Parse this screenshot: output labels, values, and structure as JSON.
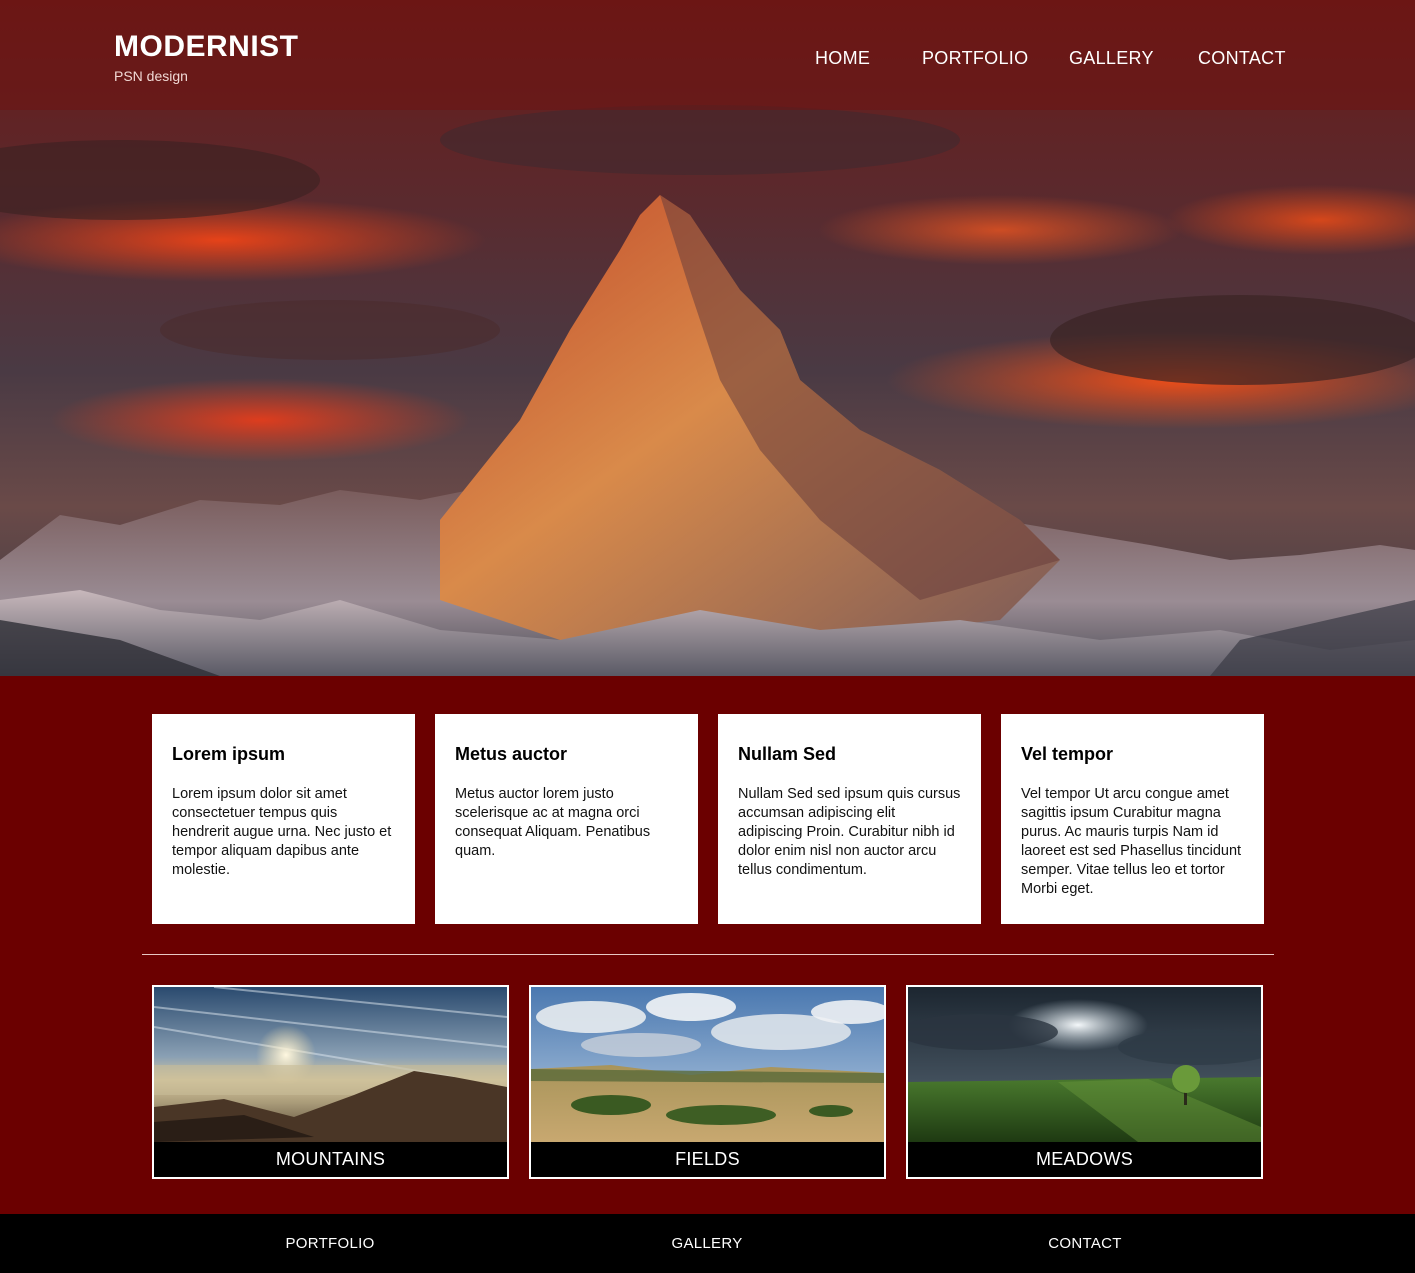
{
  "header": {
    "title": "MODERNIST",
    "subtitle": "PSN design",
    "nav": [
      "HOME",
      "PORTFOLIO",
      "GALLERY",
      "CONTACT"
    ]
  },
  "cards": [
    {
      "title": "Lorem ipsum",
      "text": "Lorem ipsum dolor sit amet consectetuer tempus quis hendrerit augue urna. Nec justo et tempor aliquam dapibus ante molestie."
    },
    {
      "title": "Metus auctor",
      "text": "Metus auctor lorem justo scelerisque ac at magna orci consequat Aliquam. Penatibus quam."
    },
    {
      "title": "Nullam Sed",
      "text": "Nullam Sed sed ipsum quis cursus accumsan adipiscing elit adipiscing Proin. Curabitur nibh id dolor enim nisl non auctor arcu tellus condimentum."
    },
    {
      "title": "Vel tempor",
      "text": "Vel tempor Ut arcu congue amet sagittis ipsum Curabitur magna purus. Ac mauris turpis Nam id laoreet est sed Phasellus tincidunt semper. Vitae tellus leo et tortor Morbi eget."
    }
  ],
  "gallery": [
    "MOUNTAINS",
    "FIELDS",
    "MEADOWS"
  ],
  "footer": {
    "links": [
      "PORTFOLIO",
      "GALLERY",
      "CONTACT"
    ]
  },
  "colors": {
    "page_background": "#6b0000",
    "header_overlay": "#6e1412",
    "card_background": "#ffffff",
    "footer_background": "#000000"
  }
}
